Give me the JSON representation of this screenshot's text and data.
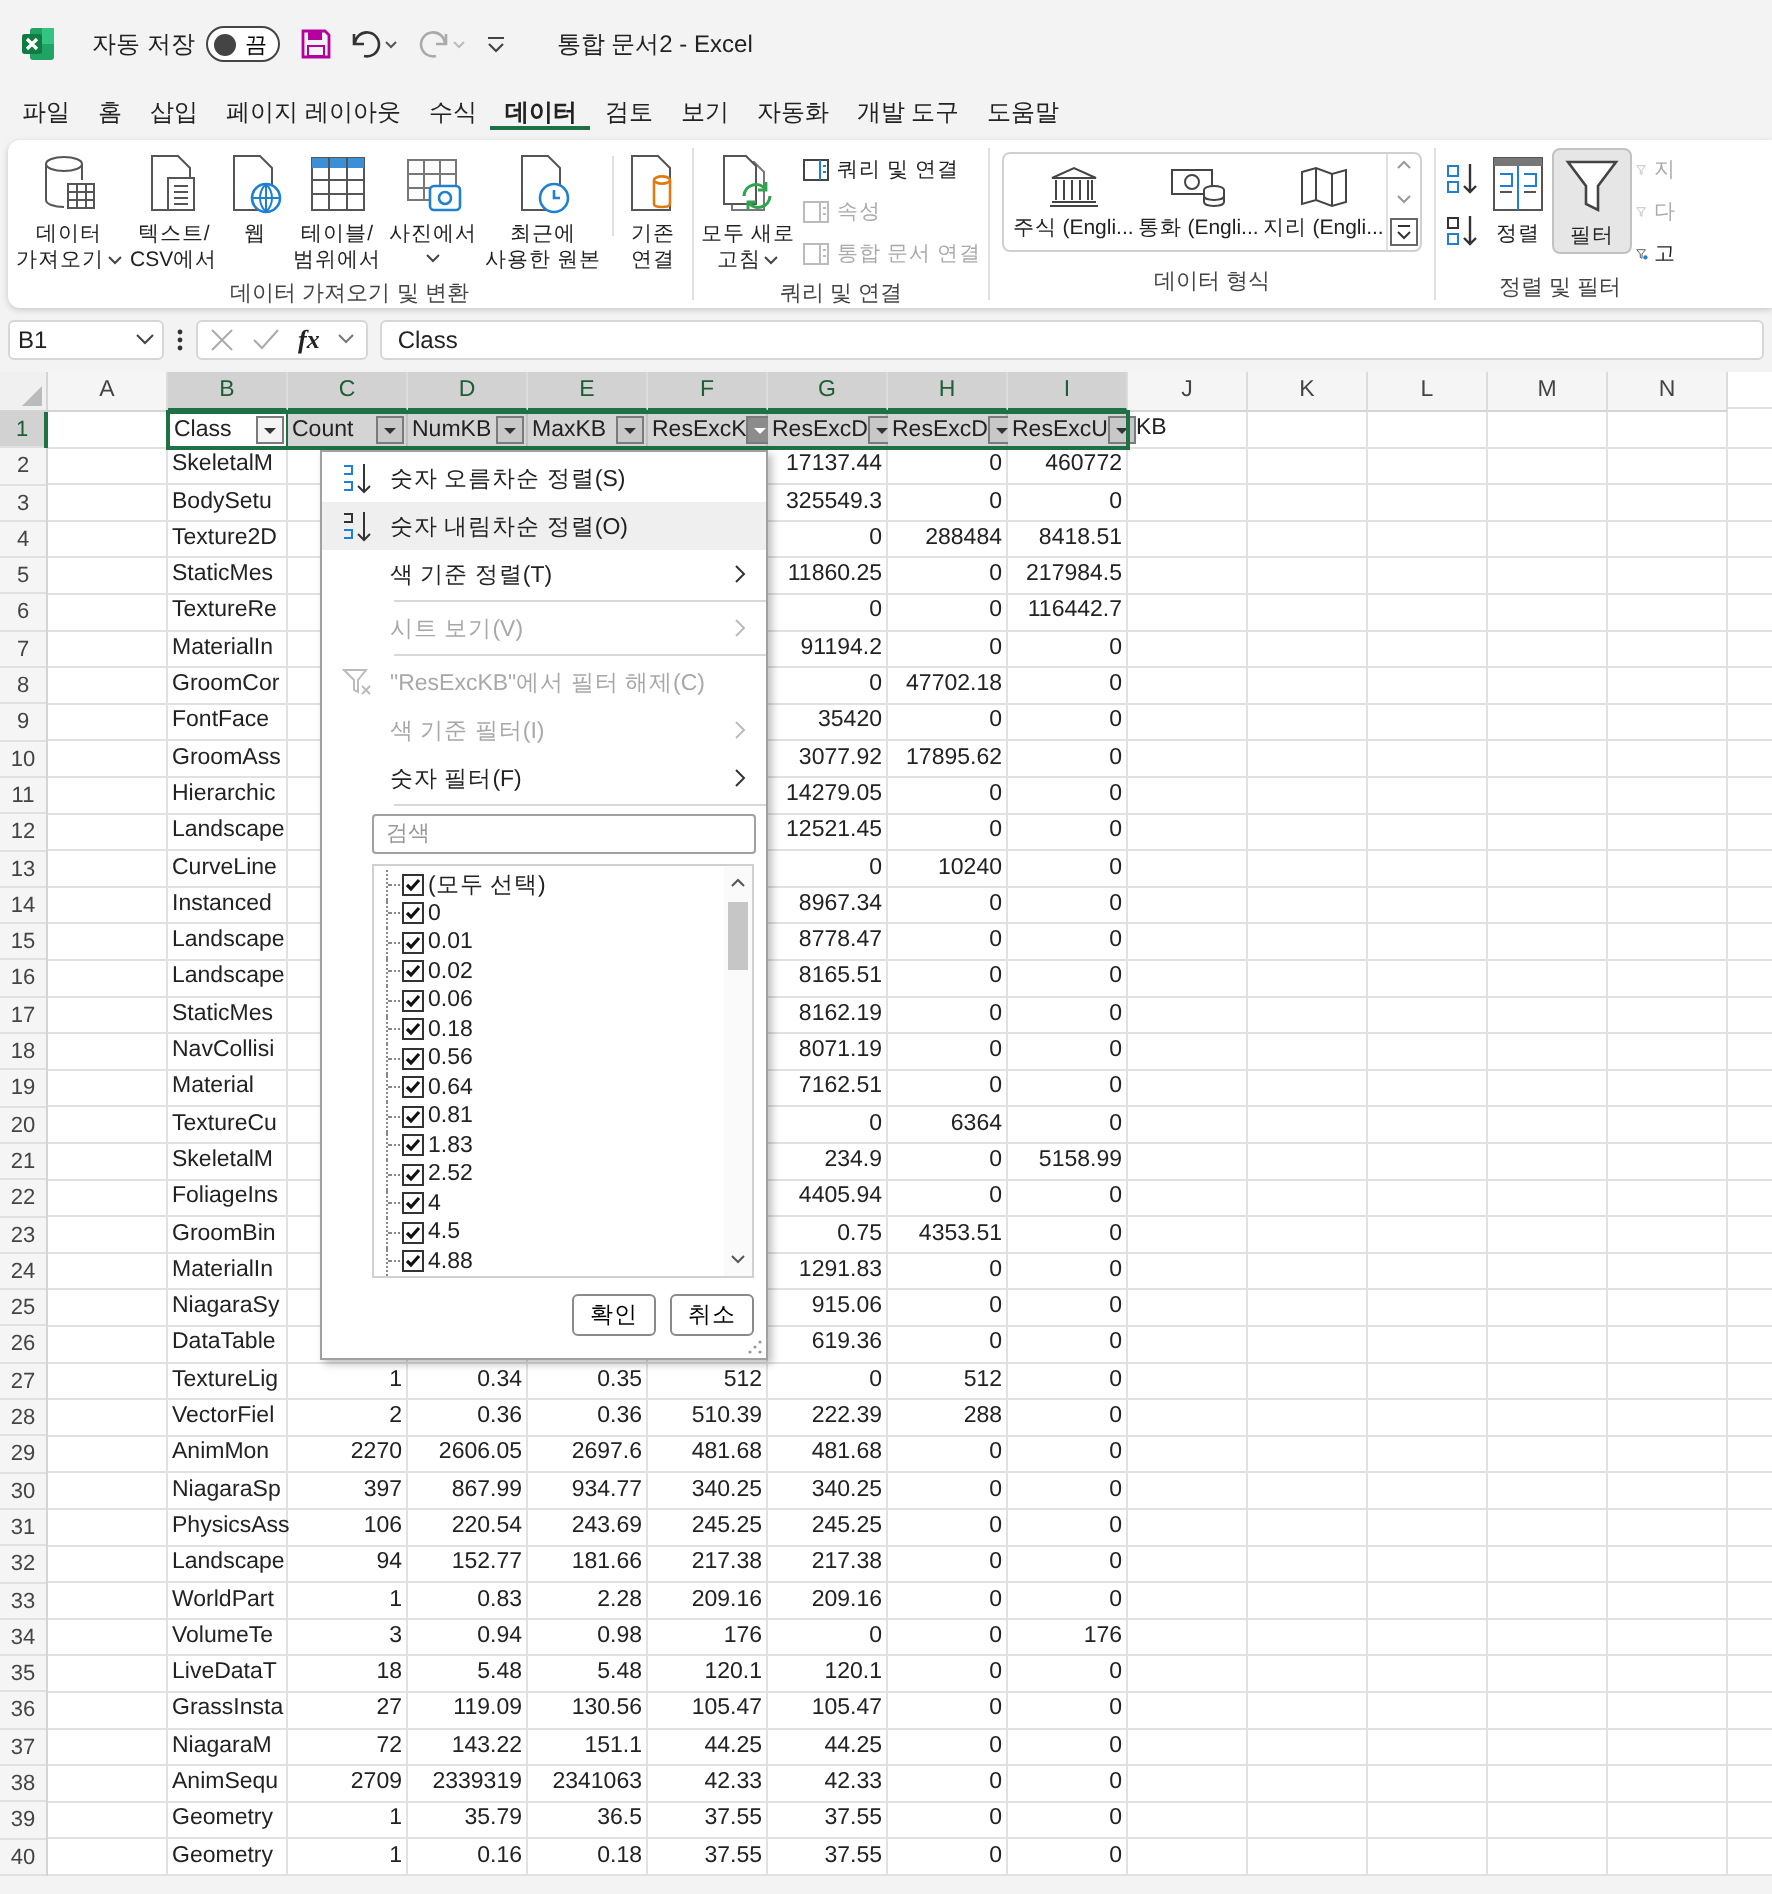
{
  "app": {
    "title": "통합 문서2  -  Excel",
    "autosave": {
      "label": "자동 저장",
      "on": false,
      "state": "끔"
    }
  },
  "menu_tabs": [
    {
      "label": "파일",
      "selected": false
    },
    {
      "label": "홈",
      "selected": false
    },
    {
      "label": "삽입",
      "selected": false
    },
    {
      "label": "페이지 레이아웃",
      "selected": false
    },
    {
      "label": "수식",
      "selected": false
    },
    {
      "label": "데이터",
      "selected": true
    },
    {
      "label": "검토",
      "selected": false
    },
    {
      "label": "보기",
      "selected": false
    },
    {
      "label": "자동화",
      "selected": false
    },
    {
      "label": "개발 도구",
      "selected": false
    },
    {
      "label": "도움말",
      "selected": false
    }
  ],
  "ribbon": {
    "groups": [
      {
        "kind": "buttons",
        "label": "데이터 가져오기 및 변환",
        "buttons": [
          {
            "label": "데이터\n가져오기",
            "caret": true
          },
          {
            "label": "텍스트/\nCSV에서"
          },
          {
            "label": "웹"
          },
          {
            "label": "테이블/\n범위에서"
          },
          {
            "label": "사진에서",
            "caret": true
          },
          {
            "label": "최근에\n사용한 원본"
          },
          {
            "label": "기존\n연결",
            "separator_before": true
          }
        ]
      },
      {
        "kind": "query",
        "label": "쿼리 및 연결",
        "buttons": [
          {
            "label": "모두 새로\n고침",
            "caret": true
          }
        ],
        "small": [
          {
            "label": "쿼리 및 연결",
            "disabled": false
          },
          {
            "label": "속성",
            "disabled": true
          },
          {
            "label": "통합 문서 연결",
            "disabled": true
          }
        ]
      },
      {
        "kind": "gallery",
        "label": "데이터 형식",
        "items": [
          "주식 (Engli...",
          "통화 (Engli...",
          "지리 (Engli..."
        ]
      },
      {
        "kind": "sort_filter",
        "label": "정렬 및 필터",
        "buttons": [
          {
            "label": "정렬",
            "selected": false
          },
          {
            "label": "필터",
            "selected": true
          }
        ],
        "small": [
          {
            "label": "지",
            "disabled": true
          },
          {
            "label": "다",
            "disabled": true
          },
          {
            "label": "고",
            "disabled": false
          }
        ]
      }
    ]
  },
  "formula_bar": {
    "name_box": "B1",
    "function_label": "fx",
    "formula": "Class"
  },
  "sheet": {
    "columns": [
      {
        "label": "A",
        "selected": false
      },
      {
        "label": "B",
        "selected": true
      },
      {
        "label": "C",
        "selected": true
      },
      {
        "label": "D",
        "selected": true
      },
      {
        "label": "E",
        "selected": true
      },
      {
        "label": "F",
        "selected": true
      },
      {
        "label": "G",
        "selected": true
      },
      {
        "label": "H",
        "selected": true
      },
      {
        "label": "I",
        "selected": true
      },
      {
        "label": "J",
        "selected": false
      },
      {
        "label": "K",
        "selected": false
      },
      {
        "label": "L",
        "selected": false
      },
      {
        "label": "M",
        "selected": false
      },
      {
        "label": "N",
        "selected": false
      }
    ],
    "header_row": {
      "num": "1",
      "selected": true,
      "cells": [
        {
          "text": ""
        },
        {
          "text": "Class",
          "filter": true,
          "active": true,
          "open": false
        },
        {
          "text": "Count",
          "filter": true,
          "active": false,
          "open": false
        },
        {
          "text": "NumKB",
          "filter": true,
          "active": false,
          "open": false
        },
        {
          "text": "MaxKB",
          "filter": true,
          "active": false,
          "open": false
        },
        {
          "text": "ResExcK",
          "filter": true,
          "active": false,
          "open": true
        },
        {
          "text": "ResExcD",
          "filter": true,
          "active": false,
          "open": false
        },
        {
          "text": "ResExcD",
          "filter": true,
          "active": false,
          "open": false
        },
        {
          "text": "ResExcU",
          "filter": true,
          "active": false,
          "open": false
        },
        {
          "text": "KB"
        }
      ]
    },
    "rows": [
      {
        "num": "2",
        "cells": [
          "",
          "SkeletalM",
          "",
          "",
          "",
          "",
          "17137.44",
          "0",
          "460772"
        ]
      },
      {
        "num": "3",
        "cells": [
          "",
          "BodySetu",
          "",
          "",
          "",
          "",
          "325549.3",
          "0",
          "0"
        ]
      },
      {
        "num": "4",
        "cells": [
          "",
          "Texture2D",
          "",
          "",
          "",
          "",
          "0",
          "288484",
          "8418.51"
        ]
      },
      {
        "num": "5",
        "cells": [
          "",
          "StaticMes",
          "",
          "",
          "",
          "",
          "11860.25",
          "0",
          "217984.5"
        ]
      },
      {
        "num": "6",
        "cells": [
          "",
          "TextureRe",
          "",
          "",
          "",
          "",
          "0",
          "0",
          "116442.7"
        ]
      },
      {
        "num": "7",
        "cells": [
          "",
          "MaterialIn",
          "",
          "",
          "",
          "",
          "91194.2",
          "0",
          "0"
        ]
      },
      {
        "num": "8",
        "cells": [
          "",
          "GroomCor",
          "",
          "",
          "",
          "",
          "0",
          "47702.18",
          "0"
        ]
      },
      {
        "num": "9",
        "cells": [
          "",
          "FontFace",
          "",
          "",
          "",
          "",
          "35420",
          "0",
          "0"
        ]
      },
      {
        "num": "10",
        "cells": [
          "",
          "GroomAss",
          "",
          "",
          "",
          "",
          "3077.92",
          "17895.62",
          "0"
        ]
      },
      {
        "num": "11",
        "cells": [
          "",
          "Hierarchic",
          "",
          "",
          "",
          "",
          "14279.05",
          "0",
          "0"
        ]
      },
      {
        "num": "12",
        "cells": [
          "",
          "Landscape",
          "",
          "",
          "",
          "",
          "12521.45",
          "0",
          "0"
        ]
      },
      {
        "num": "13",
        "cells": [
          "",
          "CurveLine",
          "",
          "",
          "",
          "",
          "0",
          "10240",
          "0"
        ]
      },
      {
        "num": "14",
        "cells": [
          "",
          "Instanced",
          "",
          "",
          "",
          "",
          "8967.34",
          "0",
          "0"
        ]
      },
      {
        "num": "15",
        "cells": [
          "",
          "Landscape",
          "",
          "",
          "",
          "",
          "8778.47",
          "0",
          "0"
        ]
      },
      {
        "num": "16",
        "cells": [
          "",
          "Landscape",
          "",
          "",
          "",
          "",
          "8165.51",
          "0",
          "0"
        ]
      },
      {
        "num": "17",
        "cells": [
          "",
          "StaticMes",
          "",
          "",
          "",
          "",
          "8162.19",
          "0",
          "0"
        ]
      },
      {
        "num": "18",
        "cells": [
          "",
          "NavCollisi",
          "",
          "",
          "",
          "",
          "8071.19",
          "0",
          "0"
        ]
      },
      {
        "num": "19",
        "cells": [
          "",
          "Material",
          "",
          "",
          "",
          "",
          "7162.51",
          "0",
          "0"
        ]
      },
      {
        "num": "20",
        "cells": [
          "",
          "TextureCu",
          "",
          "",
          "",
          "",
          "0",
          "6364",
          "0"
        ]
      },
      {
        "num": "21",
        "cells": [
          "",
          "SkeletalM",
          "",
          "",
          "",
          "",
          "234.9",
          "0",
          "5158.99"
        ]
      },
      {
        "num": "22",
        "cells": [
          "",
          "FoliageIns",
          "",
          "",
          "",
          "",
          "4405.94",
          "0",
          "0"
        ]
      },
      {
        "num": "23",
        "cells": [
          "",
          "GroomBin",
          "",
          "",
          "",
          "",
          "0.75",
          "4353.51",
          "0"
        ]
      },
      {
        "num": "24",
        "cells": [
          "",
          "MaterialIn",
          "",
          "",
          "",
          "",
          "1291.83",
          "0",
          "0"
        ]
      },
      {
        "num": "25",
        "cells": [
          "",
          "NiagaraSy",
          "",
          "",
          "",
          "",
          "915.06",
          "0",
          "0"
        ]
      },
      {
        "num": "26",
        "cells": [
          "",
          "DataTable",
          "",
          "",
          "",
          "",
          "619.36",
          "0",
          "0"
        ]
      },
      {
        "num": "27",
        "cells": [
          "",
          "TextureLig",
          "1",
          "0.34",
          "0.35",
          "512",
          "0",
          "512",
          "0"
        ]
      },
      {
        "num": "28",
        "cells": [
          "",
          "VectorFiel",
          "2",
          "0.36",
          "0.36",
          "510.39",
          "222.39",
          "288",
          "0"
        ]
      },
      {
        "num": "29",
        "cells": [
          "",
          "AnimMon",
          "2270",
          "2606.05",
          "2697.6",
          "481.68",
          "481.68",
          "0",
          "0"
        ]
      },
      {
        "num": "30",
        "cells": [
          "",
          "NiagaraSp",
          "397",
          "867.99",
          "934.77",
          "340.25",
          "340.25",
          "0",
          "0"
        ]
      },
      {
        "num": "31",
        "cells": [
          "",
          "PhysicsAss",
          "106",
          "220.54",
          "243.69",
          "245.25",
          "245.25",
          "0",
          "0"
        ]
      },
      {
        "num": "32",
        "cells": [
          "",
          "Landscape",
          "94",
          "152.77",
          "181.66",
          "217.38",
          "217.38",
          "0",
          "0"
        ]
      },
      {
        "num": "33",
        "cells": [
          "",
          "WorldPart",
          "1",
          "0.83",
          "2.28",
          "209.16",
          "209.16",
          "0",
          "0"
        ]
      },
      {
        "num": "34",
        "cells": [
          "",
          "VolumeTe",
          "3",
          "0.94",
          "0.98",
          "176",
          "0",
          "0",
          "176"
        ]
      },
      {
        "num": "35",
        "cells": [
          "",
          "LiveDataT",
          "18",
          "5.48",
          "5.48",
          "120.1",
          "120.1",
          "0",
          "0"
        ]
      },
      {
        "num": "36",
        "cells": [
          "",
          "GrassInsta",
          "27",
          "119.09",
          "130.56",
          "105.47",
          "105.47",
          "0",
          "0"
        ]
      },
      {
        "num": "37",
        "cells": [
          "",
          "NiagaraM",
          "72",
          "143.22",
          "151.1",
          "44.25",
          "44.25",
          "0",
          "0"
        ]
      },
      {
        "num": "38",
        "cells": [
          "",
          "AnimSequ",
          "2709",
          "2339319",
          "2341063",
          "42.33",
          "42.33",
          "0",
          "0"
        ]
      },
      {
        "num": "39",
        "cells": [
          "",
          "Geometry",
          "1",
          "35.79",
          "36.5",
          "37.55",
          "37.55",
          "0",
          "0"
        ]
      },
      {
        "num": "40",
        "cells": [
          "",
          "Geometry",
          "1",
          "0.16",
          "0.18",
          "37.55",
          "37.55",
          "0",
          "0"
        ]
      }
    ]
  },
  "filter_menu": {
    "items": [
      {
        "kind": "sort_asc",
        "label": "숫자 오름차순 정렬(S)",
        "highlighted": false,
        "disabled": false,
        "submenu": false
      },
      {
        "kind": "sort_desc",
        "label": "숫자 내림차순 정렬(O)",
        "highlighted": true,
        "disabled": false,
        "submenu": false
      },
      {
        "kind": "item",
        "label": "색 기준 정렬(T)",
        "highlighted": false,
        "disabled": false,
        "submenu": true
      },
      {
        "kind": "separator"
      },
      {
        "kind": "item",
        "label": "시트 보기(V)",
        "highlighted": false,
        "disabled": true,
        "submenu": true
      },
      {
        "kind": "separator"
      },
      {
        "kind": "clear_filter",
        "label": "\"ResExcKB\"에서 필터 해제(C)",
        "highlighted": false,
        "disabled": true,
        "submenu": false
      },
      {
        "kind": "item",
        "label": "색 기준 필터(I)",
        "highlighted": false,
        "disabled": true,
        "submenu": true
      },
      {
        "kind": "item",
        "label": "숫자 필터(F)",
        "highlighted": false,
        "disabled": false,
        "submenu": true
      },
      {
        "kind": "separator"
      }
    ],
    "search": {
      "placeholder": "검색"
    },
    "values": [
      {
        "label": "(모두 선택)",
        "checked": true
      },
      {
        "label": "0",
        "checked": true
      },
      {
        "label": "0.01",
        "checked": true
      },
      {
        "label": "0.02",
        "checked": true
      },
      {
        "label": "0.06",
        "checked": true
      },
      {
        "label": "0.18",
        "checked": true
      },
      {
        "label": "0.56",
        "checked": true
      },
      {
        "label": "0.64",
        "checked": true
      },
      {
        "label": "0.81",
        "checked": true
      },
      {
        "label": "1.83",
        "checked": true
      },
      {
        "label": "2.52",
        "checked": true
      },
      {
        "label": "4",
        "checked": true
      },
      {
        "label": "4.5",
        "checked": true
      },
      {
        "label": "4.88",
        "checked": true
      }
    ],
    "buttons": [
      "확인",
      "취소"
    ]
  }
}
